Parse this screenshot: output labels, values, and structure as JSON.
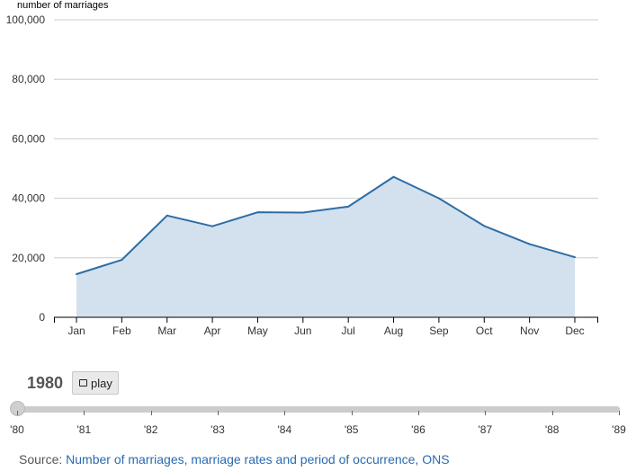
{
  "chart_data": {
    "type": "area",
    "ylabel": "number of marriages",
    "xlabel": "",
    "categories": [
      "Jan",
      "Feb",
      "Mar",
      "Apr",
      "May",
      "Jun",
      "Jul",
      "Aug",
      "Sep",
      "Oct",
      "Nov",
      "Dec"
    ],
    "values": [
      14500,
      19300,
      34200,
      30600,
      35300,
      35200,
      37200,
      47200,
      40000,
      30700,
      24600,
      20200
    ],
    "ylim": [
      0,
      100000
    ],
    "yticks": [
      0,
      20000,
      40000,
      60000,
      80000,
      100000
    ],
    "ytick_labels": [
      "0",
      "20,000",
      "40,000",
      "60,000",
      "80,000",
      "100,000"
    ],
    "grid": true,
    "line_color": "#2e6da4",
    "fill_color": "#d3e1ee",
    "grid_color": "#cccccc"
  },
  "controls": {
    "year": "1980",
    "play_label": "play",
    "play_icon": "stop-square-icon"
  },
  "timeline": {
    "years": [
      "'80",
      "'81",
      "'82",
      "'83",
      "'84",
      "'85",
      "'86",
      "'87",
      "'88",
      "'89"
    ],
    "current_index": 0
  },
  "source": {
    "prefix": "Source: ",
    "link_text": "Number of marriages, marriage rates and period of occurrence, ONS"
  }
}
